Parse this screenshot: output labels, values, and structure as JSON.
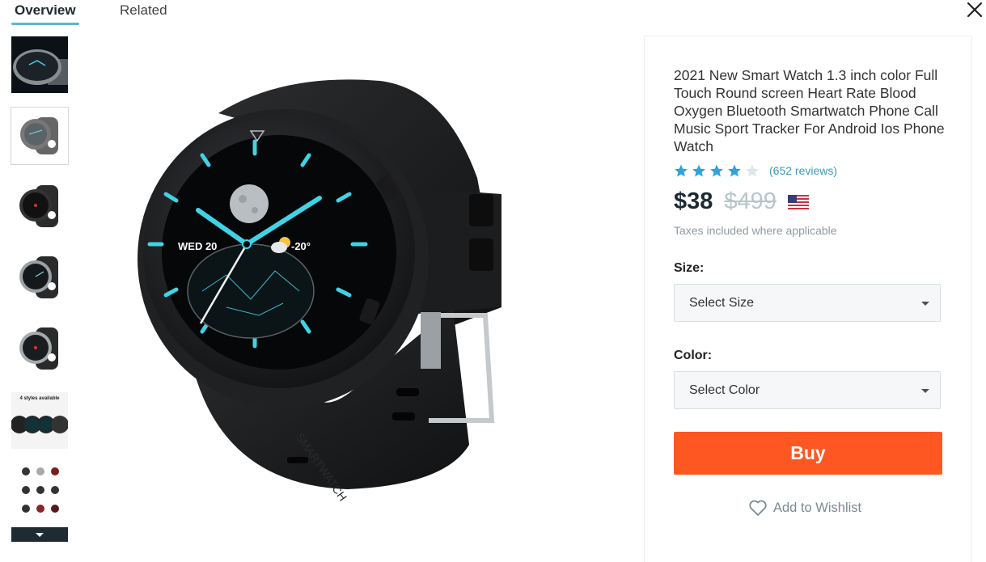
{
  "tabs": [
    {
      "label": "Overview",
      "active": true
    },
    {
      "label": "Related",
      "active": false
    }
  ],
  "close_icon": "close-icon",
  "thumbnails": {
    "count_visible": 7,
    "selected_index": 1,
    "styles_caption": "4 styles available",
    "scroll_down_icon": "chevron-down-icon"
  },
  "main_image": {
    "alt": "Black round smartwatch with silicone strap",
    "watch_face": {
      "date": "WED 20",
      "weather": "-20°",
      "strap_text": "SMARTWATCH"
    }
  },
  "product": {
    "title": "2021 New Smart Watch 1.3 inch color Full Touch Round screen Heart Rate Blood Oxygen Bluetooth Smartwatch Phone Call Music Sport Tracker For Android Ios Phone Watch",
    "rating": 4,
    "rating_max": 5,
    "reviews": "(652 reviews)",
    "price": "$38",
    "original_price": "$499",
    "currency_flag": "us-flag-icon",
    "taxes_note": "Taxes included where applicable",
    "size_label": "Size:",
    "size_placeholder": "Select Size",
    "color_label": "Color:",
    "color_placeholder": "Select Color",
    "buy_label": "Buy",
    "wishlist_label": "Add to Wishlist"
  },
  "colors": {
    "accent": "#5cb7cc",
    "buy": "#ff5722",
    "star": "#2ea3dd",
    "link": "#3a9ab7"
  }
}
